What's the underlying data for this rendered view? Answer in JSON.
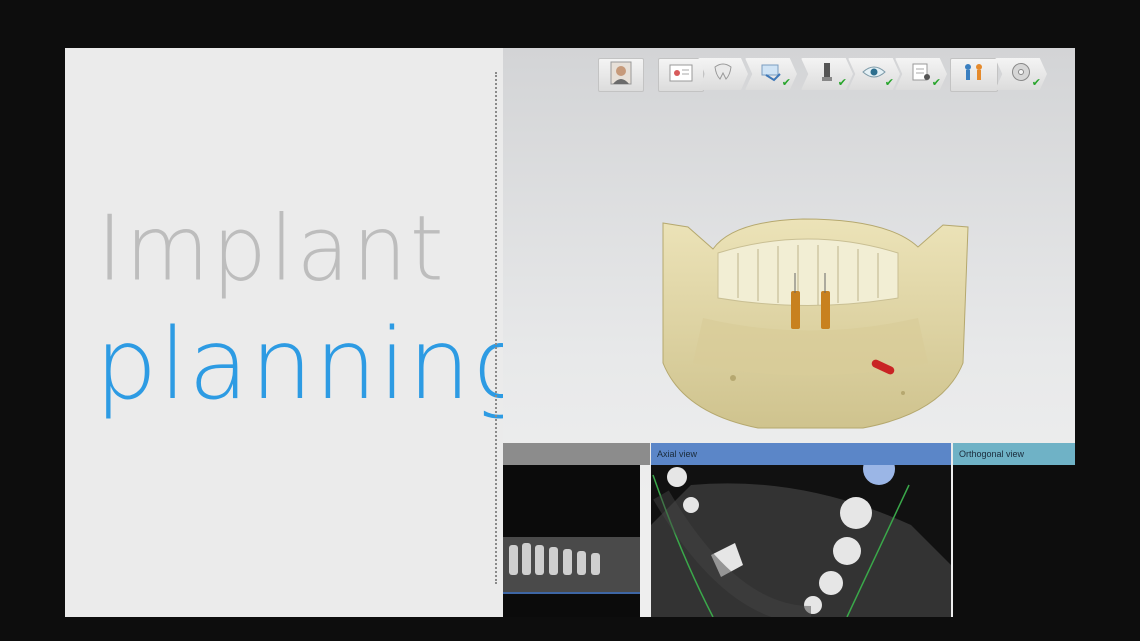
{
  "slide": {
    "title_line1": "Implant",
    "title_line2": "planning",
    "accent_color": "#2d9be3",
    "title_gray": "#bdbdbd"
  },
  "toolbar": {
    "items": [
      {
        "icon": "patient-photo-icon",
        "checked": false
      },
      {
        "icon": "dental-chart-icon",
        "checked": false
      },
      {
        "icon": "tooth-icon",
        "checked": false
      },
      {
        "icon": "scan-import-icon",
        "checked": true
      },
      {
        "icon": "implant-icon",
        "checked": true
      },
      {
        "icon": "eye-view-icon",
        "checked": true
      },
      {
        "icon": "report-icon",
        "checked": true
      },
      {
        "icon": "team-icon",
        "checked": false
      },
      {
        "icon": "disc-export-icon",
        "checked": true
      }
    ]
  },
  "views": {
    "panoramic_label": "",
    "axial_label": "Axial view",
    "orthogonal_label": "Orthogonal view"
  }
}
